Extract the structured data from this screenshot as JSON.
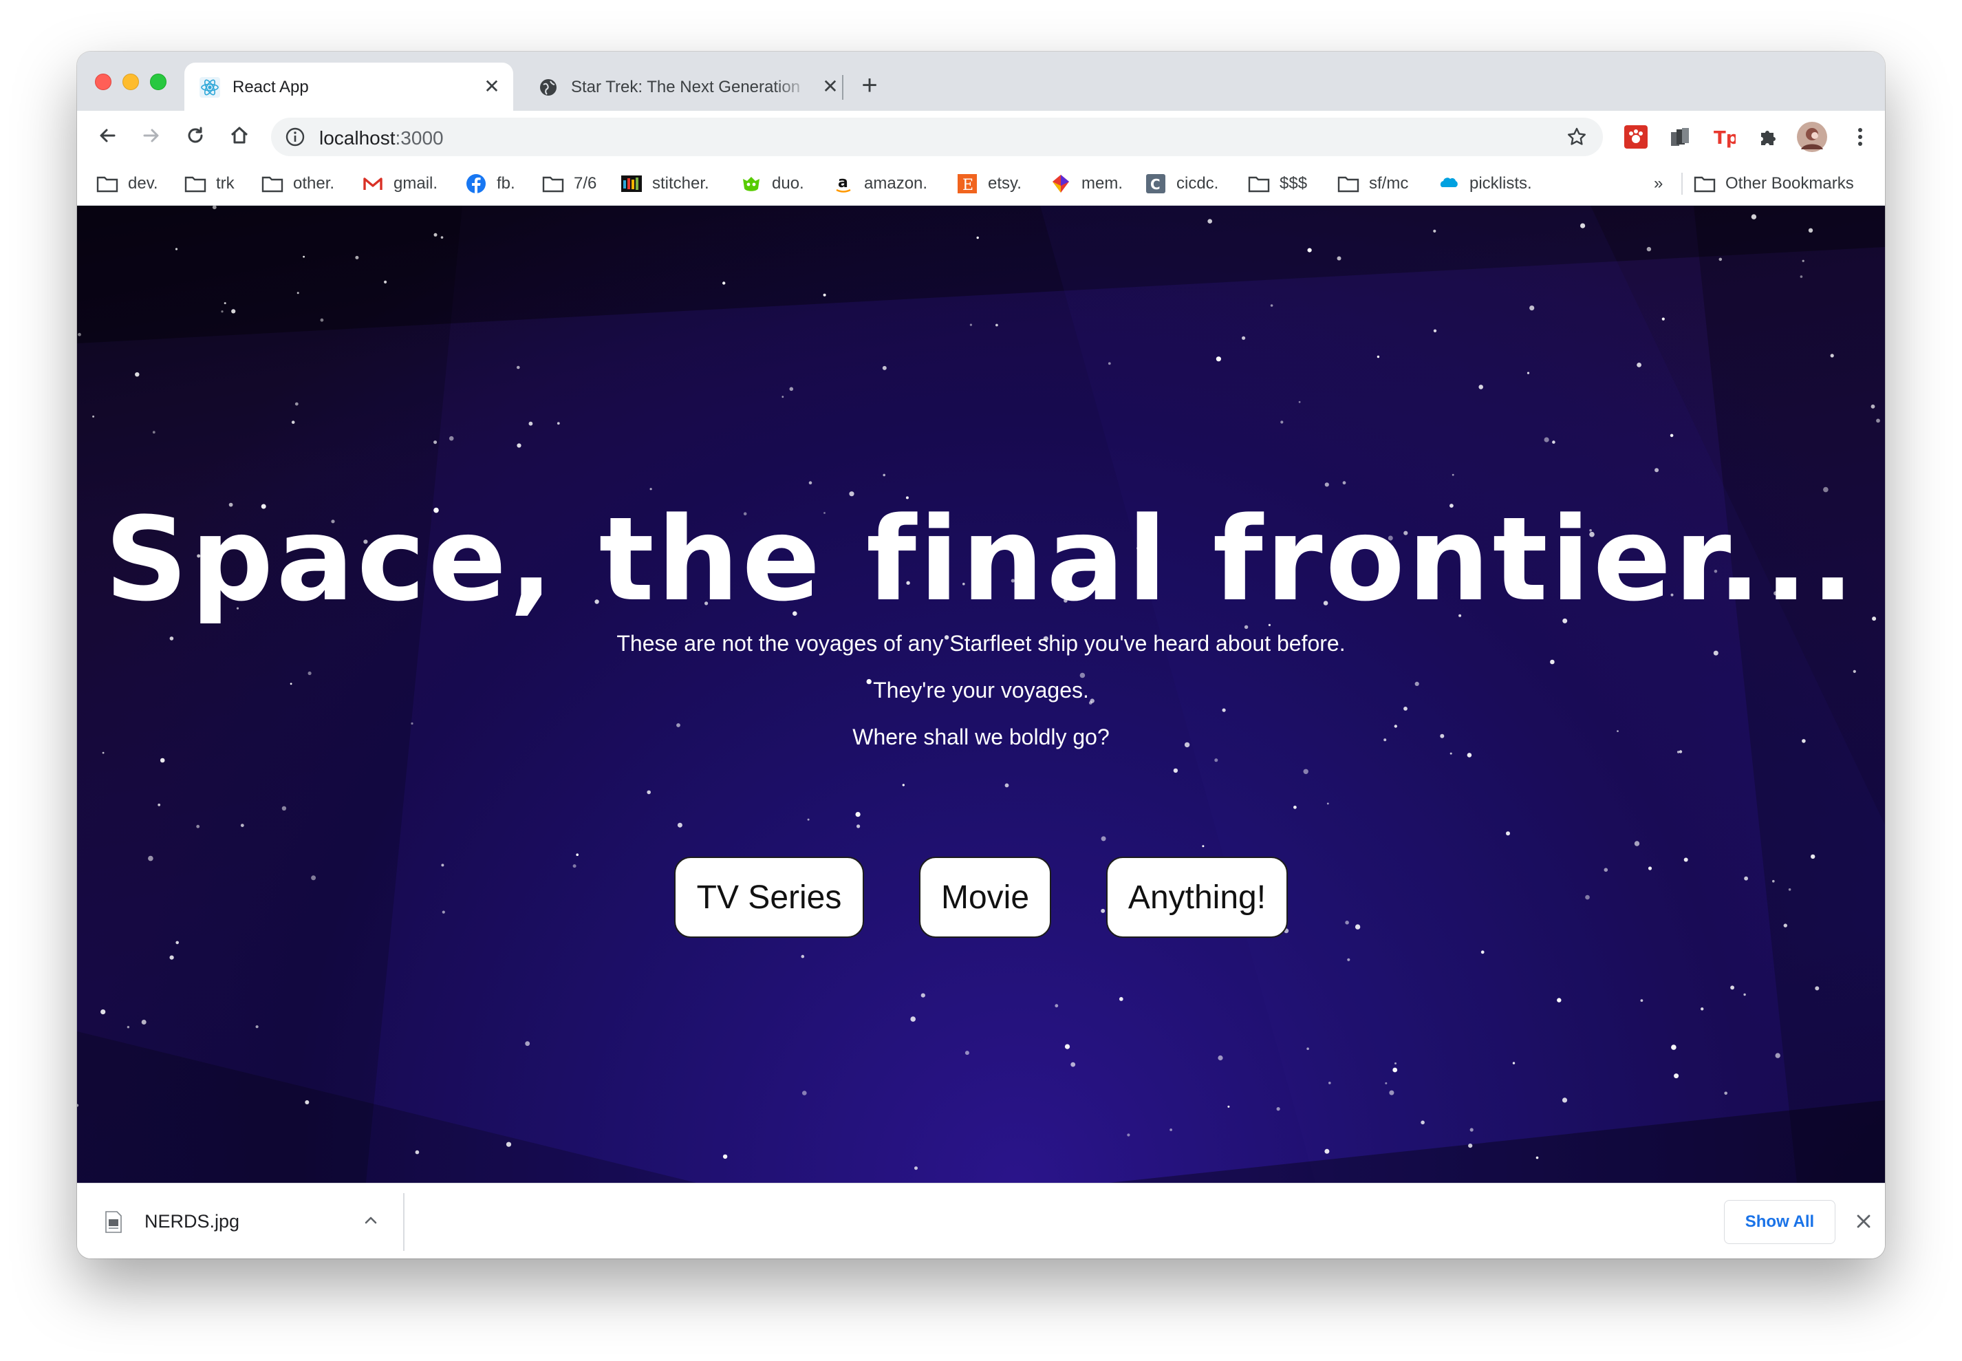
{
  "browser": {
    "tabs": [
      {
        "title": "React App",
        "active": true
      },
      {
        "title": "Star Trek: The Next Generation",
        "active": false
      }
    ],
    "new_tab": "+",
    "url_host": "localhost",
    "url_port": ":3000",
    "bookmarks": [
      {
        "label": "dev.",
        "icon": "folder-icon"
      },
      {
        "label": "trk",
        "icon": "folder-icon"
      },
      {
        "label": "other.",
        "icon": "folder-icon"
      },
      {
        "label": "gmail.",
        "icon": "gmail-icon"
      },
      {
        "label": "fb.",
        "icon": "facebook-icon"
      },
      {
        "label": "7/6",
        "icon": "folder-icon"
      },
      {
        "label": "stitcher.",
        "icon": "stitcher-icon"
      },
      {
        "label": "duo.",
        "icon": "duolingo-icon"
      },
      {
        "label": "amazon.",
        "icon": "amazon-icon"
      },
      {
        "label": "etsy.",
        "icon": "etsy-icon"
      },
      {
        "label": "mem.",
        "icon": "mem-icon"
      },
      {
        "label": "cicdc.",
        "icon": "cicdc-icon"
      },
      {
        "label": "$$$",
        "icon": "folder-icon"
      },
      {
        "label": "sf/mc",
        "icon": "folder-icon"
      },
      {
        "label": "picklists.",
        "icon": "salesforce-icon"
      }
    ],
    "bookmarks_overflow": "»",
    "other_bookmarks": "Other Bookmarks"
  },
  "page": {
    "title": "Space, the final frontier...",
    "lines": [
      "These are not the voyages of any Starfleet ship you've heard about before.",
      "They're your voyages.",
      "Where shall we boldly go?"
    ],
    "buttons": [
      "TV Series",
      "Movie",
      "Anything!"
    ]
  },
  "downloads": {
    "file_name": "NERDS.jpg",
    "show_all": "Show All"
  },
  "colors": {
    "accent_blue": "#1a73e8",
    "space_deep": "#170a4f",
    "space_glow": "#2a148a"
  }
}
